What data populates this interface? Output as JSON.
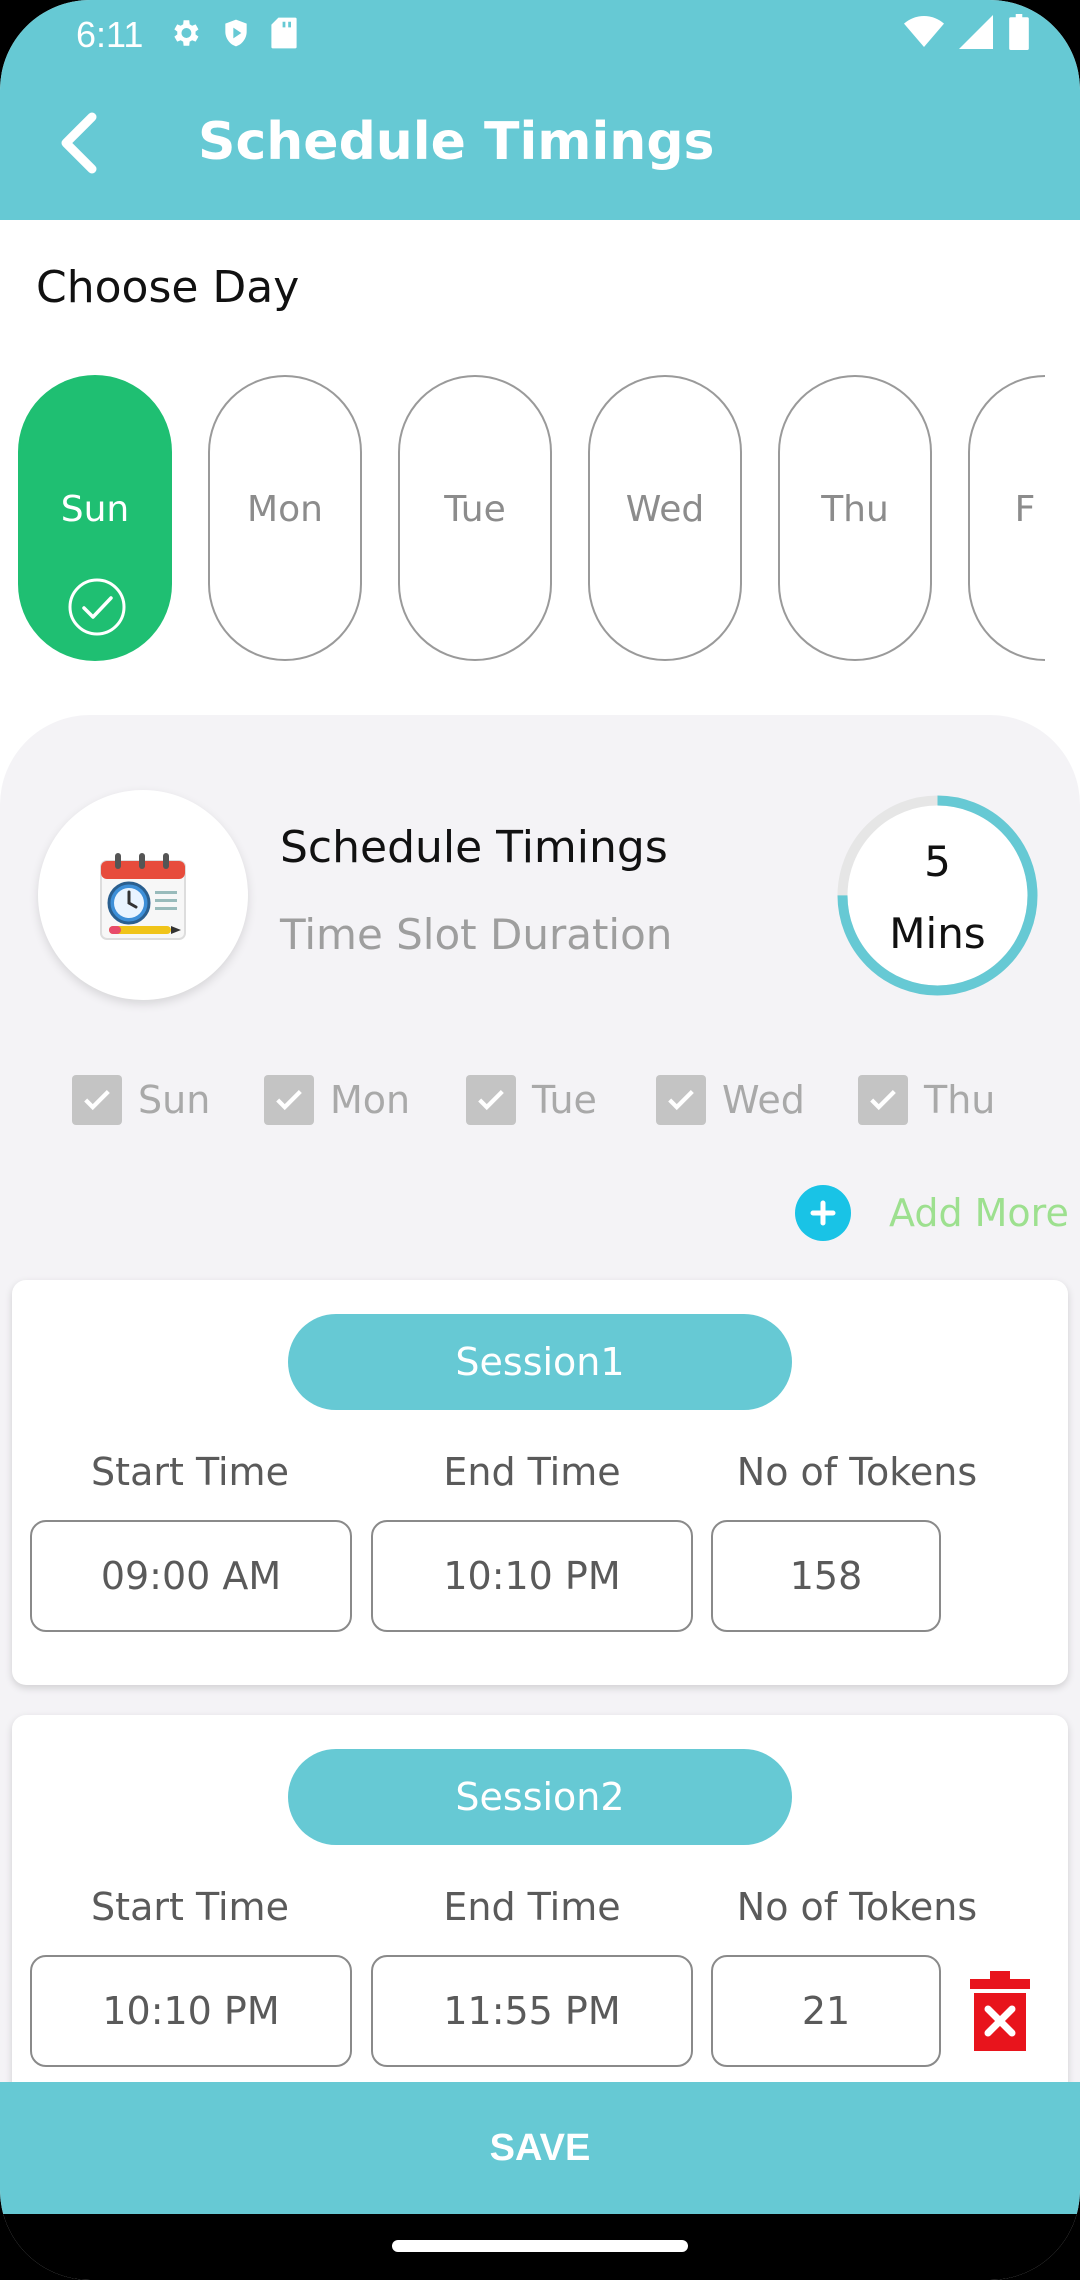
{
  "status_bar": {
    "time": "6:11",
    "left_icons": [
      "gear-icon",
      "shield-icon",
      "sd-card-icon"
    ],
    "right_icons": [
      "wifi-icon",
      "signal-icon",
      "battery-icon"
    ]
  },
  "app_bar": {
    "title": "Schedule Timings",
    "back_icon": "chevron-left-icon"
  },
  "choose_day_label": "Choose Day",
  "days": [
    {
      "label": "Sun",
      "selected": true
    },
    {
      "label": "Mon",
      "selected": false
    },
    {
      "label": "Tue",
      "selected": false
    },
    {
      "label": "Wed",
      "selected": false
    },
    {
      "label": "Thu",
      "selected": false
    },
    {
      "label": "F",
      "selected": false
    }
  ],
  "schedule": {
    "title": "Schedule Timings",
    "subtitle": "Time Slot Duration",
    "duration_value": "5",
    "duration_unit": "Mins",
    "duration_progress": 0.75
  },
  "selected_days": [
    {
      "label": "Sun",
      "checked": true
    },
    {
      "label": "Mon",
      "checked": true
    },
    {
      "label": "Tue",
      "checked": true
    },
    {
      "label": "Wed",
      "checked": true
    },
    {
      "label": "Thu",
      "checked": true
    }
  ],
  "add_more_label": "Add More",
  "column_labels": {
    "start": "Start Time",
    "end": "End Time",
    "tokens": "No of Tokens"
  },
  "sessions": [
    {
      "name": "Session1",
      "start": "09:00 AM",
      "end": "10:10 PM",
      "tokens": "158",
      "deletable": false
    },
    {
      "name": "Session2",
      "start": "10:10 PM",
      "end": "11:55 PM",
      "tokens": "21",
      "deletable": true
    }
  ],
  "save_label": "SAVE",
  "colors": {
    "primary": "#66c9d4",
    "selected_day": "#1fbf72",
    "add_icon": "#19c3e6",
    "add_text": "#9de08f",
    "delete": "#e8141c"
  }
}
